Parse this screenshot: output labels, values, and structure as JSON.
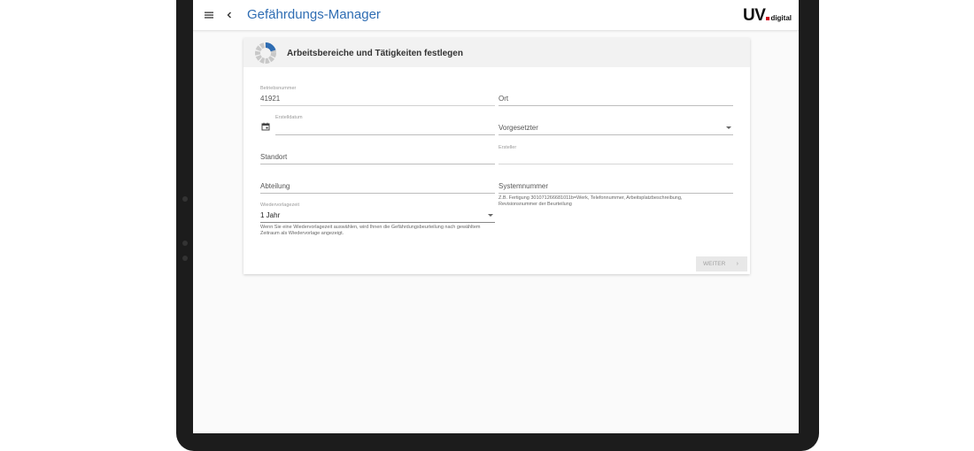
{
  "app": {
    "title": "Gefährdungs-Manager",
    "logo_text": "UV",
    "logo_sub": "digital",
    "accent_color": "#2f6db3",
    "logo_dot_color": "#d0021b"
  },
  "card": {
    "title": "Arbeitsbereiche und Tätigkeiten festlegen",
    "progress_icon": "progress-ring-icon"
  },
  "form": {
    "betriebsnummer": {
      "label": "Betriebsnummer",
      "value": "41921"
    },
    "ort": {
      "placeholder": "Ort"
    },
    "erstelldatum": {
      "label": "Erstelldatum",
      "icon": "calendar-icon"
    },
    "vorgesetzter": {
      "placeholder": "Vorgesetzter"
    },
    "standort": {
      "placeholder": "Standort"
    },
    "ersteller": {
      "label": "Ersteller"
    },
    "abteilung": {
      "placeholder": "Abteilung"
    },
    "systemnummer": {
      "placeholder": "Systemnummer",
      "hint": "Z.B. Fertigung 301071266681011b=Werk, Telefonnummer, Arbeitsplatzbeschreibung, Revisionsnummer der Beurteilung"
    },
    "wiedervorlagezeit": {
      "label": "Wiedervorlagezeit",
      "value": "1 Jahr",
      "hint": "Wenn Sie eine Wiedervorlagezeit auswählen, wird Ihnen die Gefährdungsbeurteilung nach gewähltem Zeitraum als Wiedervorlage angezeigt."
    }
  },
  "actions": {
    "weiter_label": "WEITER",
    "weiter_chevron": "›"
  }
}
